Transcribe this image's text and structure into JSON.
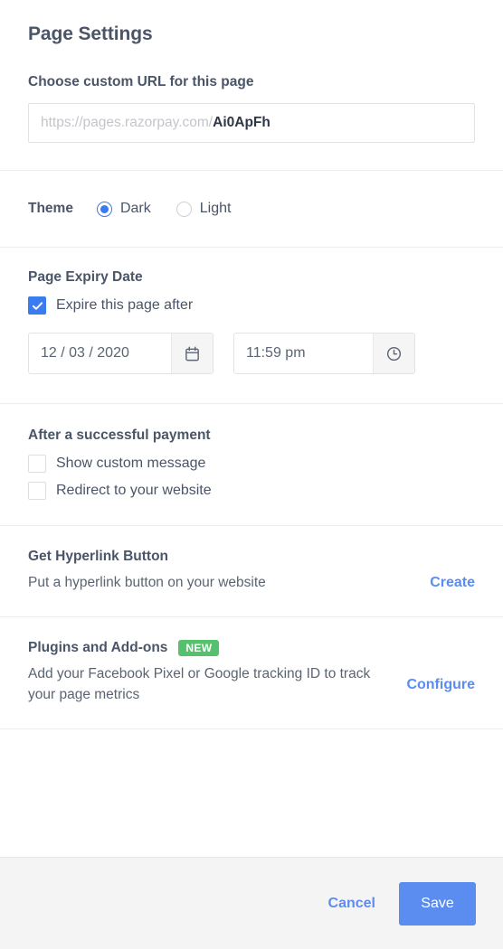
{
  "header": {
    "title": "Page Settings"
  },
  "custom_url": {
    "label": "Choose custom URL for this page",
    "prefix": "https://pages.razorpay.com/",
    "slug": "Ai0ApFh"
  },
  "theme": {
    "label": "Theme",
    "options": [
      {
        "label": "Dark",
        "selected": true
      },
      {
        "label": "Light",
        "selected": false
      }
    ]
  },
  "expiry": {
    "title": "Page Expiry Date",
    "checkbox_label": "Expire this page after",
    "checked": true,
    "date_value": "12 / 03 / 2020",
    "time_value": "11:59 pm",
    "date_icon": "calendar-icon",
    "time_icon": "clock-icon"
  },
  "after_payment": {
    "title": "After a successful payment",
    "options": [
      {
        "label": "Show custom message",
        "checked": false
      },
      {
        "label": "Redirect to your website",
        "checked": false
      }
    ]
  },
  "hyperlink": {
    "title": "Get Hyperlink Button",
    "description": "Put a hyperlink button on your website",
    "action_label": "Create"
  },
  "plugins": {
    "title": "Plugins and Add-ons",
    "badge": "NEW",
    "description": "Add your Facebook Pixel or Google tracking ID to track your page metrics",
    "action_label": "Configure"
  },
  "footer": {
    "cancel_label": "Cancel",
    "save_label": "Save"
  },
  "colors": {
    "accent_blue": "#5a8def",
    "radio_blue": "#3b7bf0",
    "badge_green": "#55c16c",
    "text_dark": "#4a5568",
    "text_muted": "#5a6472",
    "placeholder": "#c3c5ca",
    "footer_bg": "#f4f4f5"
  }
}
